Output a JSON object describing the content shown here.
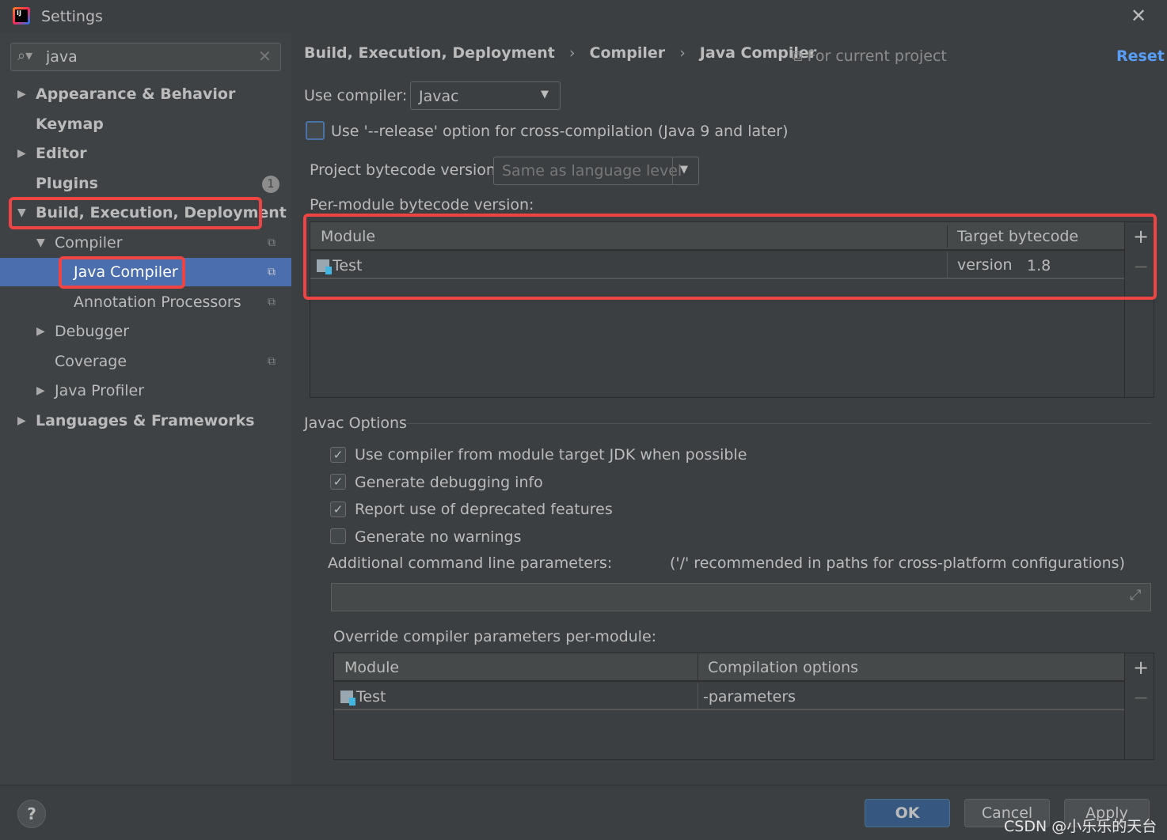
{
  "window": {
    "title": "Settings",
    "close": "✕"
  },
  "search": {
    "value": "java",
    "icon": "search-icon",
    "clear": "✕"
  },
  "tree": [
    {
      "label": "Appearance & Behavior"
    },
    {
      "label": "Keymap"
    },
    {
      "label": "Editor"
    },
    {
      "label": "Plugins",
      "badge": "1"
    },
    {
      "label": "Build, Execution, Deployment"
    },
    {
      "label": "Compiler"
    },
    {
      "label": "Java Compiler"
    },
    {
      "label": "Annotation Processors"
    },
    {
      "label": "Debugger"
    },
    {
      "label": "Coverage"
    },
    {
      "label": "Java Profiler"
    },
    {
      "label": "Languages & Frameworks"
    }
  ],
  "breadcrumb": [
    "Build, Execution, Deployment",
    "Compiler",
    "Java Compiler"
  ],
  "breadcrumb_sep": "›",
  "scope": "For current project",
  "reset": "Reset",
  "use_compiler": {
    "label": "Use compiler:",
    "value": "Javac"
  },
  "release_option": {
    "label": "Use '--release' option for cross-compilation (Java 9 and later)",
    "checked": false
  },
  "project_bytecode": {
    "label": "Project bytecode version:",
    "placeholder": "Same as language level"
  },
  "per_module": {
    "label": "Per-module bytecode version:",
    "columns": [
      "Module",
      "Target bytecode version"
    ],
    "rows": [
      {
        "module": "Test",
        "version": "1.8"
      }
    ]
  },
  "javac": {
    "title": "Javac Options",
    "options": [
      {
        "label": "Use compiler from module target JDK when possible",
        "checked": true
      },
      {
        "label": "Generate debugging info",
        "checked": true
      },
      {
        "label": "Report use of deprecated features",
        "checked": true
      },
      {
        "label": "Generate no warnings",
        "checked": false
      }
    ],
    "additional_label": "Additional command line parameters:",
    "additional_hint": "('/' recommended in paths for cross-platform configurations)",
    "additional_value": ""
  },
  "override": {
    "label": "Override compiler parameters per-module:",
    "columns": [
      "Module",
      "Compilation options"
    ],
    "rows": [
      {
        "module": "Test",
        "options": "-parameters"
      }
    ]
  },
  "buttons": {
    "ok": "OK",
    "cancel": "Cancel",
    "apply": "Apply",
    "help": "?",
    "add": "+",
    "remove": "−"
  },
  "watermark": "CSDN @小乐乐的天台",
  "colors": {
    "selection": "#4b6eaf",
    "highlight": "#ef4444",
    "link": "#589df6"
  }
}
